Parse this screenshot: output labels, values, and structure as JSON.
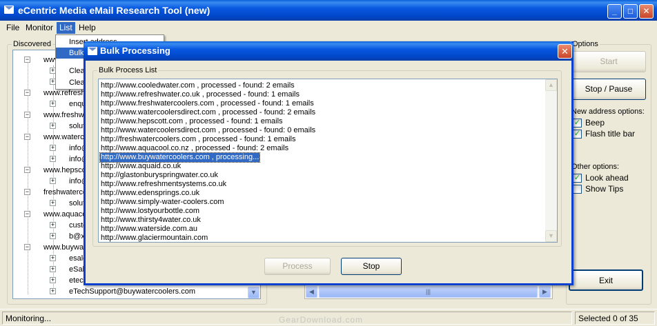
{
  "window": {
    "title": "eCentric Media eMail Research Tool (new)",
    "min_label": "_",
    "max_label": "□",
    "close_label": "✕"
  },
  "menu": [
    {
      "label": "File"
    },
    {
      "label": "Monitor"
    },
    {
      "label": "List"
    },
    {
      "label": "Help"
    }
  ],
  "dropdown": {
    "items": [
      "Insert address",
      "Bulk",
      "Clear",
      "Clear"
    ]
  },
  "discovered": {
    "legend": "Discovered",
    "rows": [
      {
        "toggle": "−",
        "text": "www."
      },
      {
        "toggle": "+",
        "text": ""
      },
      {
        "toggle": "+",
        "text": ""
      },
      {
        "toggle": "−",
        "text": "www.refresh"
      },
      {
        "toggle": "+",
        "text": "enqu"
      },
      {
        "toggle": "−",
        "text": "www.freshwa"
      },
      {
        "toggle": "+",
        "text": "solut"
      },
      {
        "toggle": "−",
        "text": "www.waterc"
      },
      {
        "toggle": "+",
        "text": "info@"
      },
      {
        "toggle": "+",
        "text": "info@"
      },
      {
        "toggle": "−",
        "text": "www.hepsco"
      },
      {
        "toggle": "+",
        "text": "info@"
      },
      {
        "toggle": "−",
        "text": "freshwaterco"
      },
      {
        "toggle": "+",
        "text": "solut"
      },
      {
        "toggle": "−",
        "text": "www.aquaco"
      },
      {
        "toggle": "+",
        "text": "custo"
      },
      {
        "toggle": "+",
        "text": "b@x"
      },
      {
        "toggle": "−",
        "text": "www.buywat"
      },
      {
        "toggle": "+",
        "text": "esale"
      },
      {
        "toggle": "+",
        "text": "eSal"
      },
      {
        "toggle": "+",
        "text": "etec"
      },
      {
        "toggle": "+",
        "text": "eTechSupport@buywatercoolers.com"
      }
    ],
    "scroll_down": "▼"
  },
  "options": {
    "legend": "Options",
    "start_label": "Start",
    "stop_pause_label": "Stop / Pause",
    "new_address_heading": "New address options:",
    "beep_label": "Beep",
    "flash_label": "Flash title bar",
    "other_heading": "Other options:",
    "look_ahead_label": "Look ahead",
    "show_tips_label": "Show Tips",
    "exit_label": "Exit",
    "check_mark": "✓"
  },
  "hscroll": {
    "left": "◀",
    "right": "▶",
    "grip": "|||"
  },
  "status": {
    "left": "Monitoring...",
    "right": "Selected 0 of 35"
  },
  "dialog": {
    "title": "Bulk Processing",
    "close_label": "✕",
    "list_legend": "Bulk Process List",
    "rows": [
      "http://www.cooledwater.com , processed - found: 2 emails",
      "http://www.refreshwater.co.uk , processed - found: 1 emails",
      "http://www.freshwatercoolers.com , processed - found: 1 emails",
      "http://www.watercoolersdirect.com , processed - found: 2 emails",
      "http://www.hepscott.com , processed - found: 1 emails",
      "http://www.watercoolersdirect.com , processed - found: 0 emails",
      "http://freshwatercoolers.com , processed - found: 1 emails",
      "http://www.aquacool.co.nz , processed - found: 2 emails",
      "http://www.buywatercoolers.com , processing...",
      "http://www.aquaid.co.uk",
      "http://glastonburyspringwater.co.uk",
      "http://www.refreshmentsystems.co.uk",
      "http://www.edensprings.co.uk",
      "http://www.simply-water-coolers.com",
      "http://www.lostyourbottle.com",
      "http://www.thirsty4water.co.uk",
      "http://www.waterside.com.au",
      "http://www.glaciermountain.com"
    ],
    "selected_index": 8,
    "scroll_up": "▲",
    "scroll_down": "▼",
    "process_label": "Process",
    "stop_label": "Stop"
  },
  "watermark": "GearDownload.com"
}
